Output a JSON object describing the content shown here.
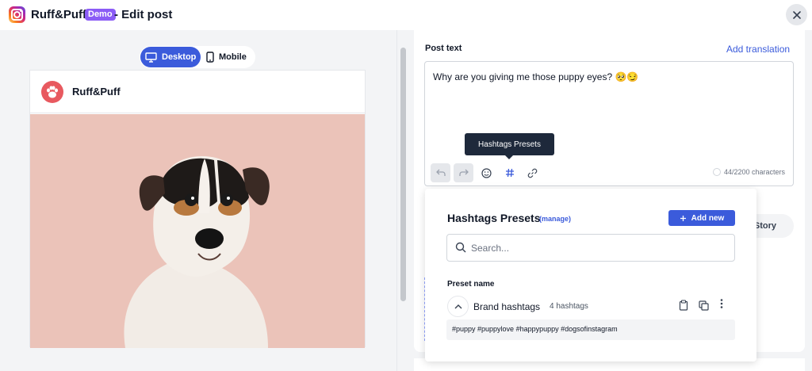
{
  "header": {
    "brand": "Ruff&Puff",
    "badge": "Demo",
    "title": "- Edit post"
  },
  "preview": {
    "toggle": {
      "desktop": "Desktop",
      "mobile": "Mobile",
      "active": "Desktop"
    },
    "author": "Ruff&Puff"
  },
  "editor": {
    "label": "Post text",
    "add_translation": "Add translation",
    "text": "Why are you giving me those puppy eyes? 🥺😏",
    "char_count": "44/2200 characters",
    "tooltip": "Hashtags Presets",
    "tools": [
      "undo-icon",
      "redo-icon",
      "emoji-icon",
      "hashtag-icon",
      "link-icon"
    ]
  },
  "story_button": "Story",
  "presets": {
    "title": "Hashtags Presets",
    "manage": "(manage)",
    "add_new": "Add new",
    "search_placeholder": "Search...",
    "column_header": "Preset name",
    "items": [
      {
        "name": "Brand hashtags",
        "count": "4 hashtags",
        "tags": "#puppy #puppylove #happypuppy #dogsofinstagram"
      }
    ]
  },
  "colors": {
    "accent": "#3b5bdb",
    "badge": "#8b5cf6",
    "tooltip": "#1e293b",
    "avatar": "#e8595f"
  }
}
